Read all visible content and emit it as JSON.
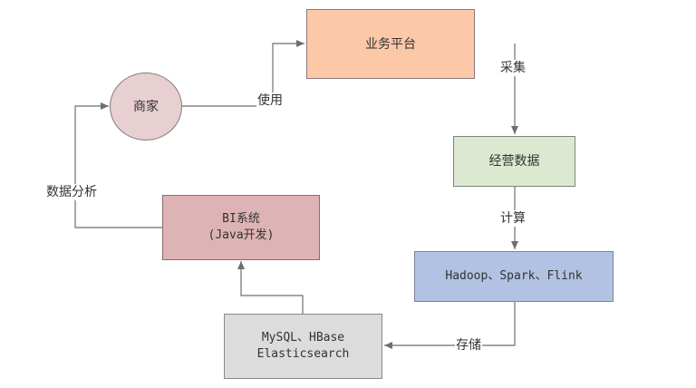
{
  "nodes": {
    "merchant": {
      "label": "商家",
      "fill": "#e8cfd1",
      "stroke": "#8a7a7c"
    },
    "platform": {
      "label": "业务平台",
      "fill": "#fbc8a8",
      "stroke": "#8a7a7c"
    },
    "data": {
      "label": "经营数据",
      "fill": "#dde8d1",
      "stroke": "#7a867a"
    },
    "bigdata": {
      "label": "Hadoop、Spark、Flink",
      "fill": "#b1c2e2",
      "stroke": "#7a84a0"
    },
    "storage": {
      "line1": "MySQL、HBase",
      "line2": "Elasticsearch",
      "fill": "#dcdcdc",
      "stroke": "#8a8a8a"
    },
    "bi": {
      "line1": "BI系统",
      "line2": "(Java开发)",
      "fill": "#deb3b5",
      "stroke": "#8a6a6c"
    }
  },
  "edges": {
    "use": "使用",
    "collect": "采集",
    "compute": "计算",
    "store": "存储",
    "analyze": "数据分析"
  },
  "colors": {
    "line": "#6e6e6e"
  }
}
